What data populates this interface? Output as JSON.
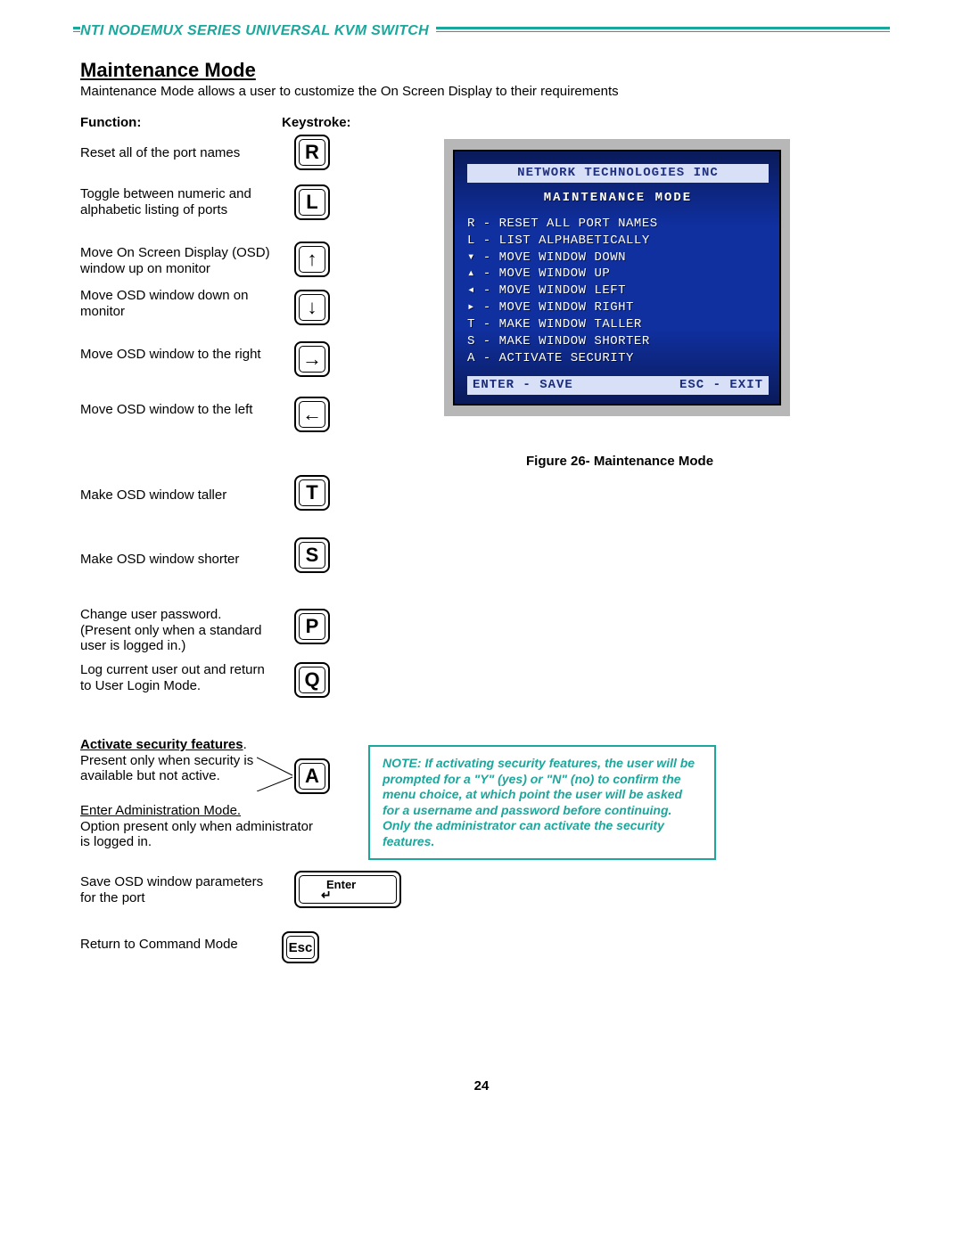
{
  "header": "NTI NODEMUX SERIES UNIVERSAL KVM SWITCH",
  "title": "Maintenance Mode",
  "subtitle": "Maintenance Mode allows a user to customize the On Screen Display to their requirements",
  "col_function": "Function:",
  "col_keystroke": "Keystroke:",
  "functions": {
    "reset": "Reset all of the port names",
    "toggle1": "Toggle between numeric and",
    "toggle2": "alphabetic listing of ports",
    "up1": "Move On Screen Display (OSD)",
    "up2": "window up on monitor",
    "down1": "Move OSD window down on",
    "down2": "monitor",
    "right": "Move OSD window to the right",
    "left": "Move OSD window to the left",
    "taller": "Make OSD window taller",
    "shorter": "Make OSD window shorter",
    "pw1": "Change user password.",
    "pw2": "(Present only when a standard",
    "pw3": "user is logged in.)",
    "logout1": "Log current user out and return",
    "logout2": "to User Login Mode.",
    "sec_head": "Activate security features",
    "sec1": "Present only when security is",
    "sec2": "available but not active.",
    "admin_head": "Enter Administration Mode.",
    "admin1": "Option present only when administrator",
    "admin2": "is logged in.",
    "save1": "Save OSD window parameters",
    "save2": "for the port",
    "return": "Return to Command Mode"
  },
  "keys": {
    "R": "R",
    "L": "L",
    "T": "T",
    "S": "S",
    "P": "P",
    "Q": "Q",
    "A": "A",
    "up": "↑",
    "down": "↓",
    "right": "→",
    "left": "←",
    "enter": "Enter",
    "esc": "Esc"
  },
  "crt": {
    "company": "NETWORK TECHNOLOGIES INC",
    "mode": "MAINTENANCE MODE",
    "lines": [
      "R - RESET ALL PORT NAMES",
      "L - LIST ALPHABETICALLY",
      "▾ - MOVE WINDOW DOWN",
      "▴ - MOVE WINDOW UP",
      "◂ - MOVE WINDOW LEFT",
      "▸ - MOVE WINDOW RIGHT",
      "T - MAKE WINDOW TALLER",
      "S - MAKE WINDOW SHORTER",
      "A - ACTIVATE SECURITY"
    ],
    "footer_left": "ENTER - SAVE",
    "footer_right": "ESC - EXIT"
  },
  "figure_caption": "Figure 26- Maintenance Mode",
  "note": "NOTE: If activating security features, the user will be prompted for a \"Y\" (yes) or \"N\" (no) to confirm the menu choice, at which point the user will be asked for a username and password before continuing.   Only the administrator can activate the security features.",
  "page_number": "24"
}
